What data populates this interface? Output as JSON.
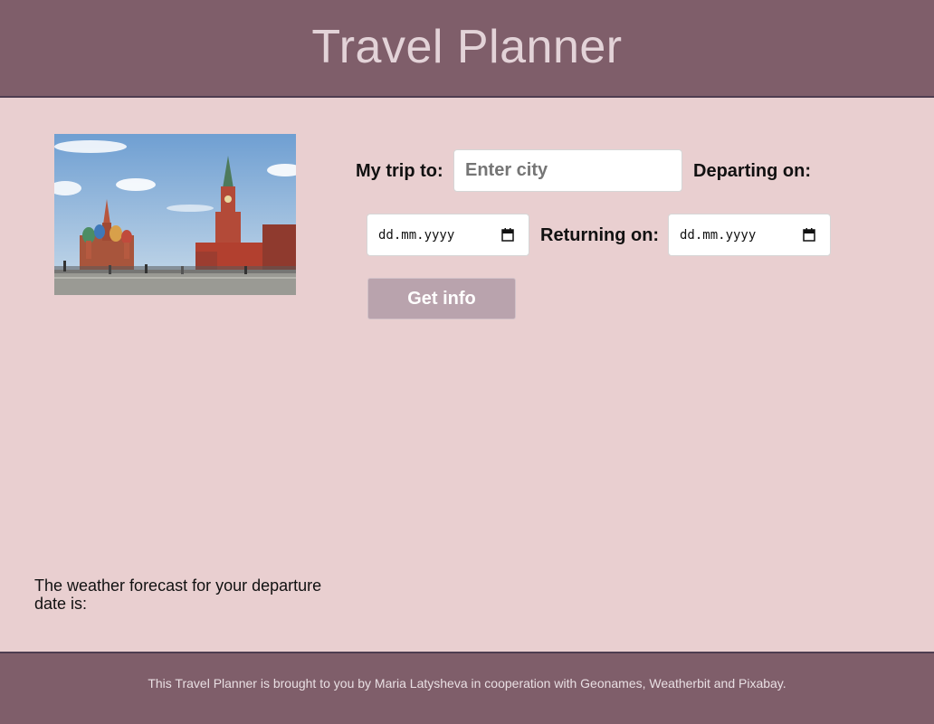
{
  "header": {
    "title": "Travel Planner"
  },
  "form": {
    "trip_label": "My trip to:",
    "city_placeholder": "Enter city",
    "departing_label": "Departing on:",
    "departing_value": "dd.mm.yyyy",
    "returning_label": "Returning on:",
    "returning_value": "dd.mm.yyyy",
    "submit_label": "Get info",
    "calendar_icon": "calendar-icon"
  },
  "photo": {
    "subject": "destination-photo"
  },
  "forecast": {
    "text": "The weather forecast for your departure date is:"
  },
  "footer": {
    "text": "This Travel Planner is brought to you by Maria Latysheva in cooperation with Geonames, Weatherbit and Pixabay."
  },
  "colors": {
    "background": "#e9cfd0",
    "header": "#7f5e6a",
    "button": "#b9a3ad"
  }
}
